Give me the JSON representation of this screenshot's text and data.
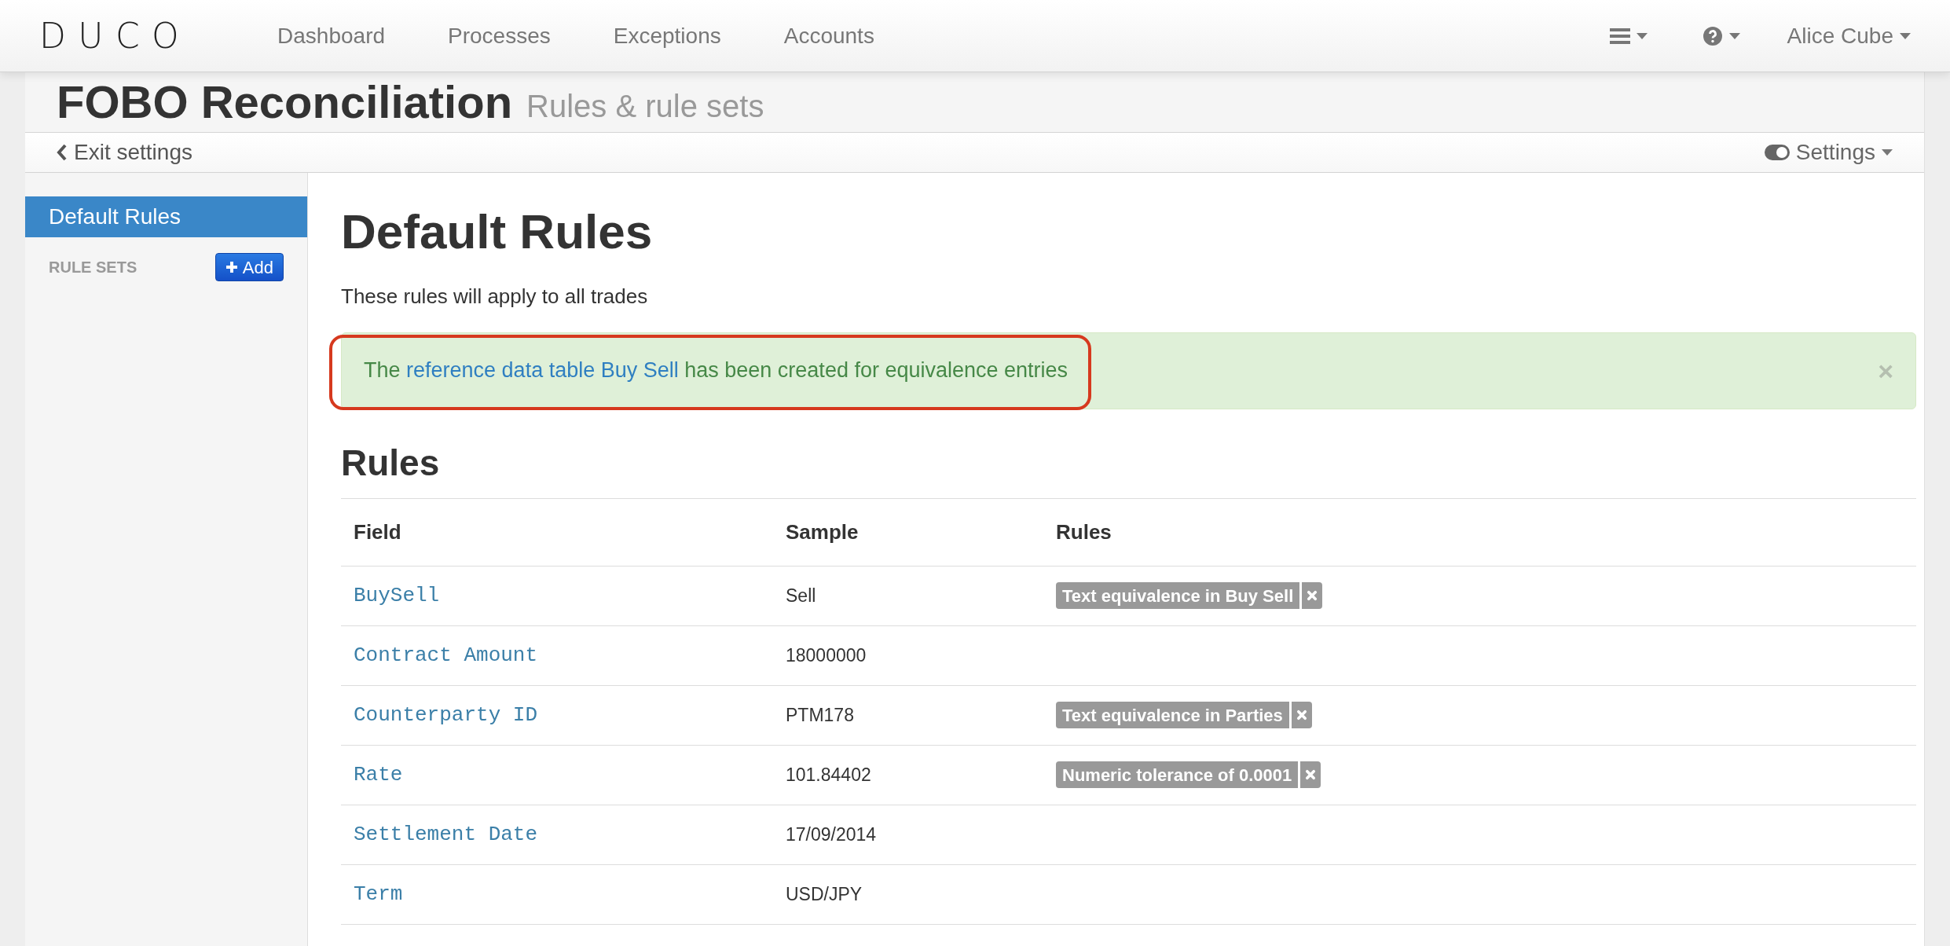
{
  "navbar": {
    "logo": "DUCO",
    "items": [
      {
        "label": "Dashboard",
        "selected": false
      },
      {
        "label": "Processes",
        "selected": false
      },
      {
        "label": "Exceptions",
        "selected": false
      },
      {
        "label": "Accounts",
        "selected": false
      }
    ],
    "user": "Alice Cube"
  },
  "page_header": {
    "title": "FOBO Reconciliation",
    "subtitle": "Rules & rule sets"
  },
  "settings_bar": {
    "back": "Exit settings",
    "settings": "Settings"
  },
  "sidebar": {
    "items": [
      {
        "label": "Default Rules",
        "selected": true
      }
    ],
    "section": "RULE SETS",
    "add_button": "Add"
  },
  "content": {
    "title": "Default Rules",
    "description": "These rules will apply to all trades",
    "alert": {
      "before": "The ",
      "link": "reference data table Buy Sell",
      "after": " has been created for equivalence entries",
      "close": "×"
    },
    "rules_heading": "Rules",
    "table": {
      "columns": [
        "Field",
        "Sample",
        "Rules"
      ],
      "rows": [
        {
          "field": "BuySell",
          "sample": "Sell",
          "rules": [
            "Text equivalence in Buy Sell"
          ]
        },
        {
          "field": "Contract Amount",
          "sample": "18000000",
          "rules": []
        },
        {
          "field": "Counterparty ID",
          "sample": "PTM178",
          "rules": [
            "Text equivalence in Parties"
          ]
        },
        {
          "field": "Rate",
          "sample": "101.84402",
          "rules": [
            "Numeric tolerance of 0.0001"
          ]
        },
        {
          "field": "Settlement Date",
          "sample": "17/09/2014",
          "rules": []
        },
        {
          "field": "Term",
          "sample": "USD/JPY",
          "rules": []
        }
      ]
    }
  }
}
